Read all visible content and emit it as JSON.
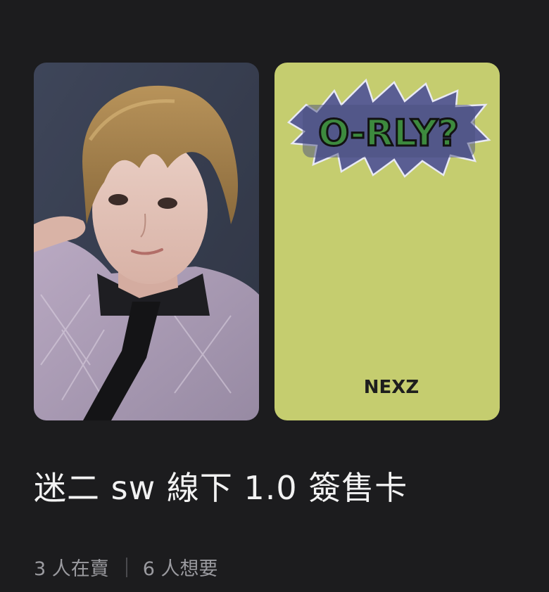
{
  "listing": {
    "title": "迷二 sw 線下 1.0 簽售卡",
    "selling_count": "3 人在賣",
    "wanting_count": "6 人想要"
  },
  "card_back": {
    "logo_text": "O-RLY?",
    "brand_text": "NEXZ"
  },
  "colors": {
    "background": "#1c1c1e",
    "card_back": "#c5cd6f",
    "title_text": "#f2f2f2",
    "stats_text": "#9a9a9f"
  }
}
